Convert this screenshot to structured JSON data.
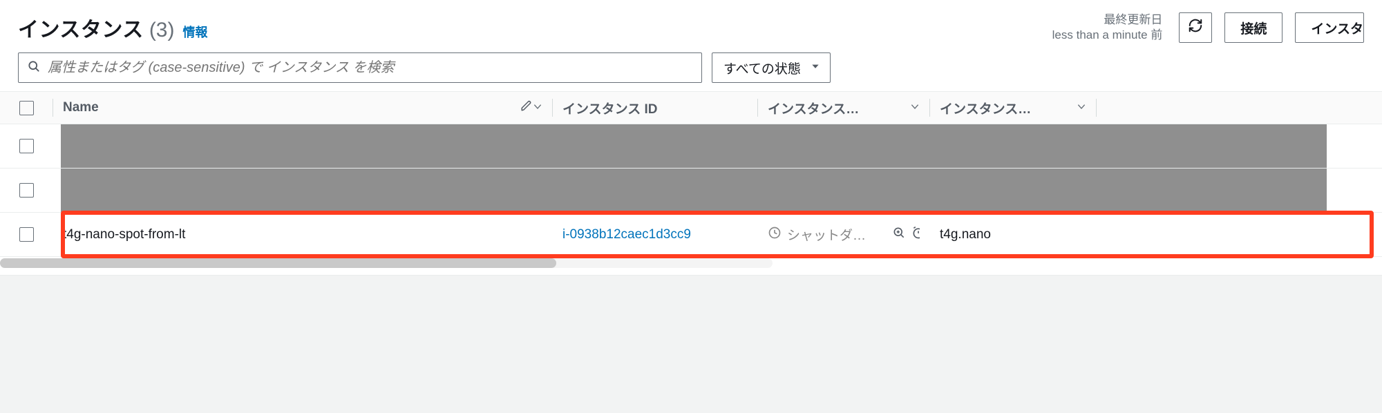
{
  "header": {
    "title": "インスタンス",
    "count": "(3)",
    "info_label": "情報",
    "last_updated_label": "最終更新日",
    "last_updated_value": "less than a minute 前",
    "connect_label": "接続",
    "instance_button_truncated": "インスタ"
  },
  "filter": {
    "search_placeholder": "属性またはタグ (case-sensitive) で インスタンス を検索",
    "state_filter_label": "すべての状態"
  },
  "columns": {
    "name": "Name",
    "id": "インスタンス ID",
    "state": "インスタンス…",
    "type": "インスタンス…"
  },
  "rows": [
    {
      "name": "",
      "id": "",
      "state": "",
      "type": "",
      "redacted": true
    },
    {
      "name": "",
      "id": "",
      "state": "",
      "type": "",
      "redacted": true
    },
    {
      "name": "t4g-nano-spot-from-lt",
      "id": "i-0938b12caec1d3cc9",
      "state": "シャットダ…",
      "type": "t4g.nano",
      "highlighted": true
    }
  ]
}
